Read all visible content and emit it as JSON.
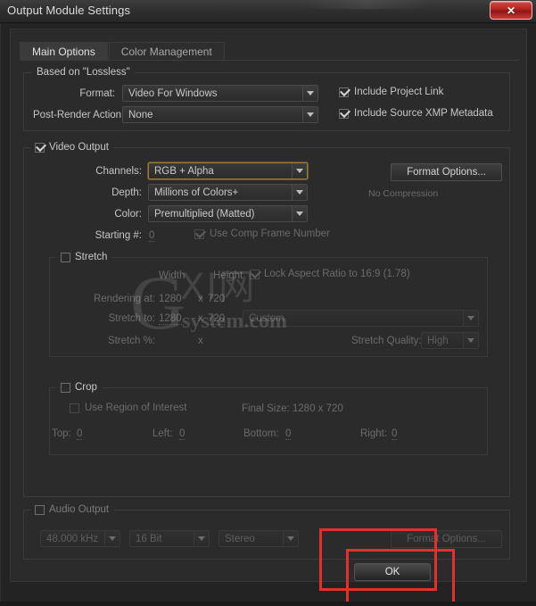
{
  "window": {
    "title": "Output Module Settings",
    "close_label": "✕"
  },
  "tabs": [
    {
      "label": "Main Options",
      "active": true
    },
    {
      "label": "Color Management",
      "active": false
    }
  ],
  "based_on": {
    "group_label": "Based on \"Lossless\"",
    "format_label": "Format:",
    "format_value": "Video For Windows",
    "post_render_label": "Post-Render Action:",
    "post_render_value": "None",
    "include_project_link": "Include Project Link",
    "include_xmp": "Include Source XMP Metadata"
  },
  "video_output": {
    "group_label": "Video Output",
    "channels_label": "Channels:",
    "channels_value": "RGB + Alpha",
    "depth_label": "Depth:",
    "depth_value": "Millions of Colors+",
    "color_label": "Color:",
    "color_value": "Premultiplied (Matted)",
    "starting_label": "Starting #:",
    "starting_value": "0",
    "use_comp_frame_number": "Use Comp Frame Number",
    "format_options_button": "Format Options...",
    "compression_status": "No Compression"
  },
  "stretch": {
    "group_label": "Stretch",
    "width_header": "Width",
    "height_header": "Height",
    "lock_aspect": "Lock Aspect Ratio to 16:9 (1.78)",
    "rendering_at_label": "Rendering at:",
    "rendering_at_width": "1280",
    "rendering_at_x": "x",
    "rendering_at_height": "720",
    "stretch_to_label": "Stretch to:",
    "stretch_to_width": "1280",
    "stretch_to_x": "x",
    "stretch_to_height": "720",
    "preset_value": "Custom",
    "stretch_pct_label": "Stretch %:",
    "stretch_pct_x": "x",
    "quality_label": "Stretch Quality:",
    "quality_value": "High"
  },
  "crop": {
    "group_label": "Crop",
    "use_roi": "Use Region of Interest",
    "final_size": "Final Size: 1280 x 720",
    "top_label": "Top:",
    "top_value": "0",
    "left_label": "Left:",
    "left_value": "0",
    "bottom_label": "Bottom:",
    "bottom_value": "0",
    "right_label": "Right:",
    "right_value": "0"
  },
  "audio_output": {
    "group_label": "Audio Output",
    "rate_value": "48.000 kHz",
    "depth_value": "16 Bit",
    "channels_value": "Stereo",
    "format_options_button": "Format Options..."
  },
  "footer": {
    "ok_label": "OK"
  },
  "watermark": {
    "glyph": "G",
    "chinese": "XI网",
    "domain": "system.com"
  },
  "colors": {
    "accent_highlight": "#9c7b3e",
    "annotation_red": "#e0312c",
    "close_red": "#b52522",
    "dialog_bg": "#2b2b2b",
    "text": "#c6c6c6"
  }
}
